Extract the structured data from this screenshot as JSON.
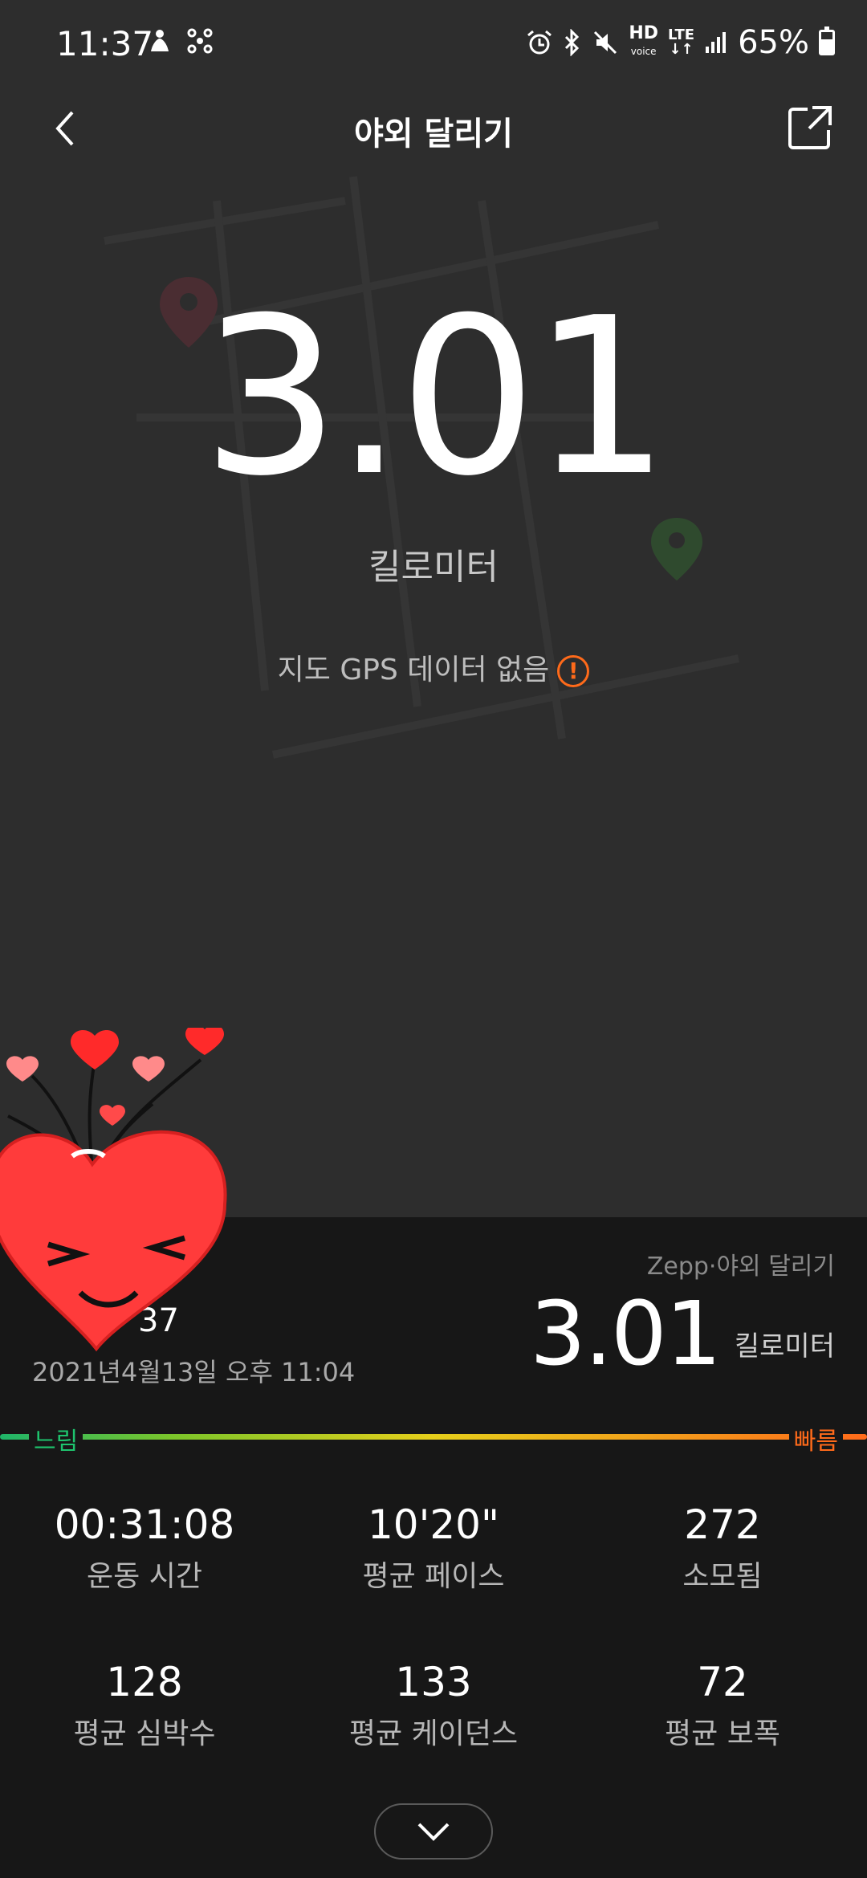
{
  "status_bar": {
    "time": "11:37",
    "battery": "65%",
    "hd": "HD",
    "hd_sub": "voice",
    "lte": "LTE"
  },
  "header": {
    "title": "야외 달리기"
  },
  "map": {
    "distance": "3.01",
    "unit": "킬로미터",
    "no_gps": "지도 GPS 데이터 없음",
    "warn_glyph": "!"
  },
  "summary": {
    "source": "Zepp·야외 달리기",
    "distance": "3.01",
    "unit": "킬로미터",
    "elapsed_partial": "37",
    "datetime": "2021년4월13일 오후 11:04"
  },
  "speed_scale": {
    "slow": "느림",
    "fast": "빠름"
  },
  "stats": [
    {
      "value": "00:31:08",
      "label": "운동 시간"
    },
    {
      "value": "10'20\"",
      "label": "평균 페이스"
    },
    {
      "value": "272",
      "label": "소모됨"
    },
    {
      "value": "128",
      "label": "평균 심박수"
    },
    {
      "value": "133",
      "label": "평균 케이던스"
    },
    {
      "value": "72",
      "label": "평균 보폭"
    }
  ],
  "colors": {
    "accent": "#ff6a1a",
    "slow": "#1ec46e",
    "background": "#2b2b2b",
    "panel": "#171717"
  }
}
